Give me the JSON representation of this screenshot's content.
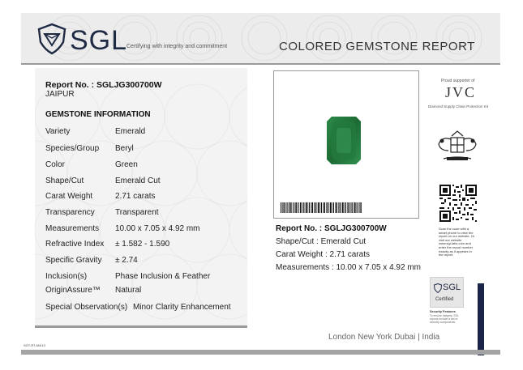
{
  "header": {
    "logo_text": "SGL",
    "tagline": "Certifying with integrity and commitment",
    "report_title": "COLORED GEMSTONE REPORT"
  },
  "left": {
    "report_no": "Report No. : SGLJG300700W",
    "city": "JAIPUR",
    "section_title": "GEMSTONE INFORMATION",
    "rows": [
      {
        "key": "Variety",
        "value": "Emerald"
      },
      {
        "key": "Species/Group",
        "value": "Beryl"
      },
      {
        "key": "Color",
        "value": "Green"
      },
      {
        "key": "Shape/Cut",
        "value": "Emerald Cut"
      },
      {
        "key": "Carat Weight",
        "value": "2.71 carats"
      },
      {
        "key": "Transparency",
        "value": "Transparent"
      },
      {
        "key": "Measurements",
        "value": "10.00 x 7.05 x 4.92 mm"
      },
      {
        "key": "Refractive Index",
        "value": "± 1.582 - 1.590"
      },
      {
        "key": "Specific Gravity",
        "value": "± 2.74"
      },
      {
        "key": "Inclusion(s)",
        "value": "Phase Inclusion & Feather"
      },
      {
        "key": "OriginAssure™",
        "value": "Natural"
      }
    ],
    "special_key": "Special Observation(s)",
    "special_value": "Minor Clarity Enhancement",
    "small_code": "SGT-RT-M4/13"
  },
  "right": {
    "report_no": "Report No. : SGLJG300700W",
    "shape_cut": "Shape/Cut : Emerald Cut",
    "carat_weight": "Carat Weight : 2.71 carats",
    "measurements": "Measurements : 10.00 x 7.05 x 4.92 mm"
  },
  "sidebar": {
    "proud": "Proud supporter of",
    "jvc": "JVC",
    "jvc_sub": "Diamond Supply Chain Protection Kit",
    "scan_text": "Scan the code with a smart phone to view the report on our website. Or visit our website www.sgl-labs.com and enter the report number exactly as it appears in the report.",
    "badge_logo": "SGL",
    "badge_label": "Certified",
    "security_title": "Security Features",
    "security_text": "To ensure integrity, SGL reports include a set of security components."
  },
  "footer": {
    "cities": "London  New York  Dubai  |  India"
  },
  "colors": {
    "navy": "#1a2447",
    "emerald": "#1f7a3c",
    "header_bg": "#ececec"
  }
}
